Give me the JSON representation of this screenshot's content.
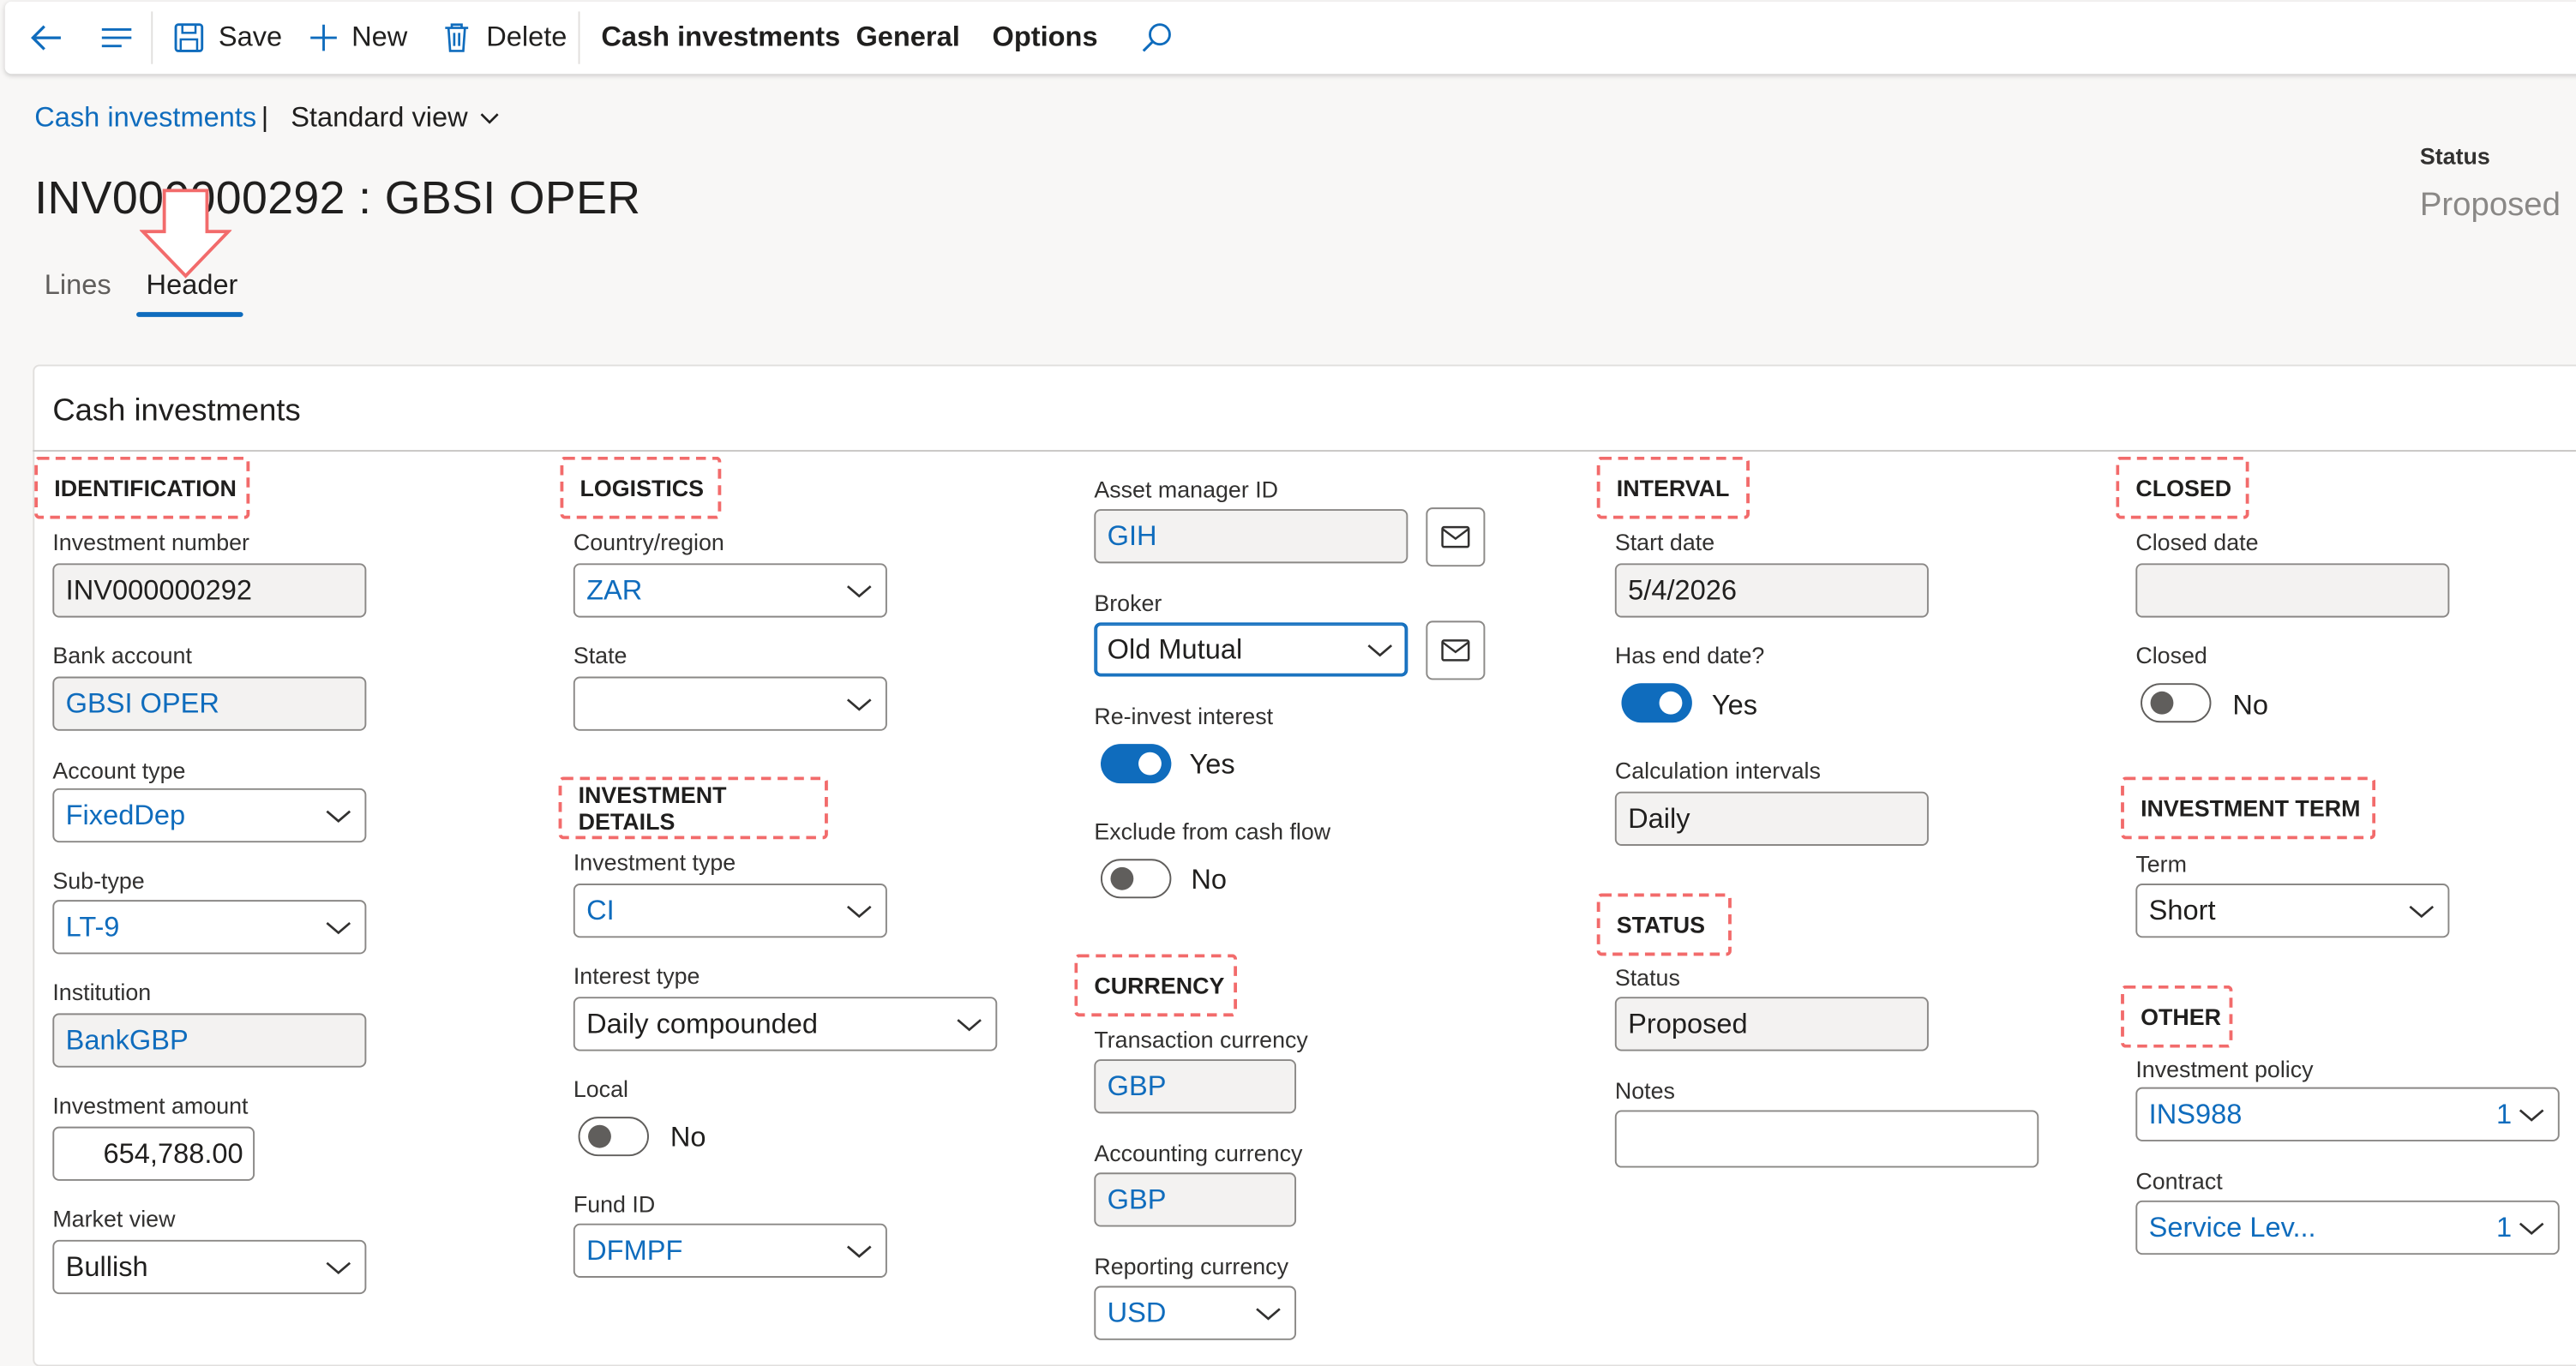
{
  "toolbar": {
    "save": "Save",
    "new": "New",
    "delete": "Delete",
    "menus": [
      "Cash investments",
      "General",
      "Options"
    ]
  },
  "breadcrumb": {
    "link": "Cash investments",
    "separator": "|",
    "view": "Standard view"
  },
  "page": {
    "title": "INV000000292 : GBSI OPER",
    "status_label": "Status",
    "status_value": "Proposed"
  },
  "tabs": [
    "Lines",
    "Header"
  ],
  "card": {
    "title": "Cash investments"
  },
  "identification": {
    "heading": "IDENTIFICATION",
    "investment_number_label": "Investment number",
    "investment_number": "INV000000292",
    "bank_account_label": "Bank account",
    "bank_account": "GBSI OPER",
    "account_type_label": "Account type",
    "account_type": "FixedDep",
    "sub_type_label": "Sub-type",
    "sub_type": "LT-9",
    "institution_label": "Institution",
    "institution": "BankGBP",
    "investment_amount_label": "Investment amount",
    "investment_amount": "654,788.00",
    "market_view_label": "Market view",
    "market_view": "Bullish"
  },
  "logistics": {
    "heading": "LOGISTICS",
    "country_label": "Country/region",
    "country": "ZAR",
    "state_label": "State",
    "state": ""
  },
  "investment_details": {
    "heading": "INVESTMENT DETAILS",
    "investment_type_label": "Investment type",
    "investment_type": "CI",
    "interest_type_label": "Interest type",
    "interest_type": "Daily compounded",
    "local_label": "Local",
    "local": "No",
    "fund_id_label": "Fund ID",
    "fund_id": "DFMPF"
  },
  "middle": {
    "asset_manager_label": "Asset manager ID",
    "asset_manager": "GIH",
    "broker_label": "Broker",
    "broker": "Old Mutual",
    "reinvest_label": "Re-invest interest",
    "reinvest": "Yes",
    "exclude_label": "Exclude from cash flow",
    "exclude": "No"
  },
  "currency": {
    "heading": "CURRENCY",
    "transaction_label": "Transaction currency",
    "transaction": "GBP",
    "accounting_label": "Accounting currency",
    "accounting": "GBP",
    "reporting_label": "Reporting currency",
    "reporting": "USD"
  },
  "interval": {
    "heading": "INTERVAL",
    "start_date_label": "Start date",
    "start_date": "5/4/2026",
    "has_end_label": "Has end date?",
    "has_end": "Yes",
    "calc_label": "Calculation intervals",
    "calc": "Daily"
  },
  "status_group": {
    "heading": "STATUS",
    "status_label": "Status",
    "status": "Proposed",
    "notes_label": "Notes",
    "notes": ""
  },
  "closed": {
    "heading": "CLOSED",
    "closed_date_label": "Closed date",
    "closed_date": "",
    "closed_label": "Closed",
    "closed": "No"
  },
  "term": {
    "heading": "INVESTMENT TERM",
    "term_label": "Term",
    "term": "Short"
  },
  "other": {
    "heading": "OTHER",
    "policy_label": "Investment policy",
    "policy": "INS988",
    "policy_suffix": "1",
    "contract_label": "Contract",
    "contract": "Service Lev...",
    "contract_suffix": "1"
  },
  "colors": {
    "accent": "#0f6cbd",
    "annotation": "#f26b6b"
  }
}
